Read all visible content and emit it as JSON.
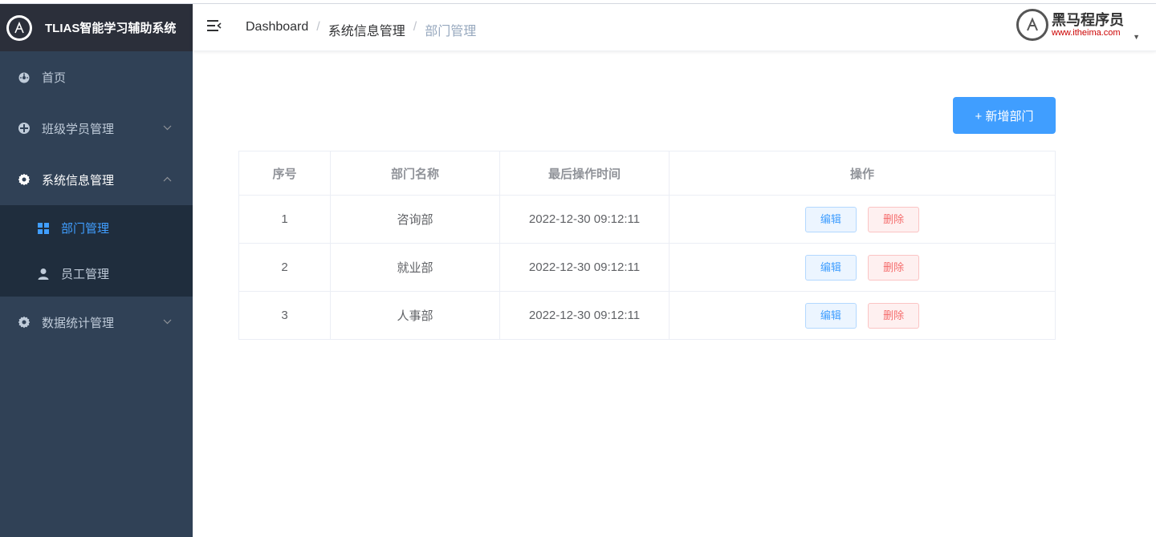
{
  "brand": {
    "title": "TLIAS智能学习辅助系统"
  },
  "sidebar": {
    "items": [
      {
        "label": "首页",
        "icon": "dashboard-icon"
      },
      {
        "label": "班级学员管理",
        "icon": "component-icon"
      },
      {
        "label": "系统信息管理",
        "icon": "gear-icon"
      },
      {
        "label": "数据统计管理",
        "icon": "gear-icon"
      }
    ],
    "submenu": [
      {
        "label": "部门管理",
        "icon": "grid-icon",
        "active": true
      },
      {
        "label": "员工管理",
        "icon": "user-icon",
        "active": false
      }
    ]
  },
  "breadcrumb": {
    "home": "Dashboard",
    "parent": "系统信息管理",
    "current": "部门管理"
  },
  "logo": {
    "title": "黑马程序员",
    "url": "www.itheima.com"
  },
  "toolbar": {
    "add_label": "+ 新增部门"
  },
  "table": {
    "headers": [
      "序号",
      "部门名称",
      "最后操作时间",
      "操作"
    ],
    "rows": [
      {
        "idx": "1",
        "name": "咨询部",
        "time": "2022-12-30 09:12:11"
      },
      {
        "idx": "2",
        "name": "就业部",
        "time": "2022-12-30 09:12:11"
      },
      {
        "idx": "3",
        "name": "人事部",
        "time": "2022-12-30 09:12:11"
      }
    ],
    "edit_label": "编辑",
    "delete_label": "删除"
  },
  "colors": {
    "sidebar_bg": "#304156",
    "accent": "#409eff",
    "danger": "#f56c6c"
  }
}
